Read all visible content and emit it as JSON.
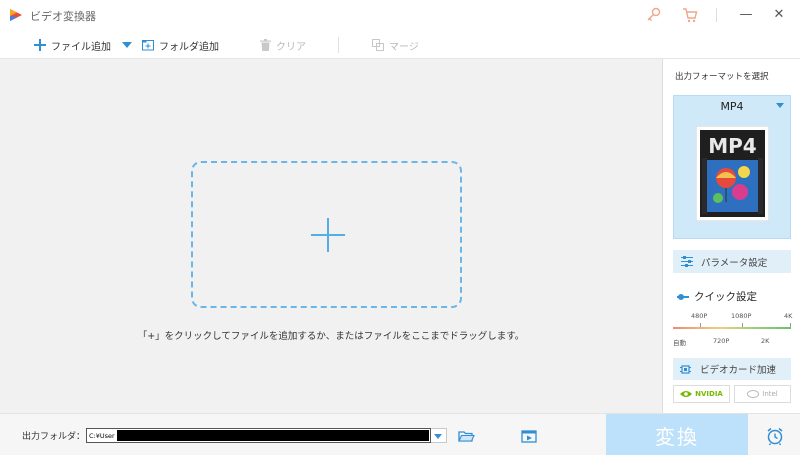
{
  "app": {
    "title": "ビデオ変換器"
  },
  "window": {
    "key_icon": "key-icon",
    "cart_icon": "cart-icon",
    "minimize": "—",
    "close": "✕"
  },
  "toolbar": {
    "add_file": "ファイル追加",
    "add_folder": "フォルダ追加",
    "clear": "クリア",
    "merge": "マージ"
  },
  "workspace": {
    "drop_hint": "「+」をクリックしてファイルを追加するか、またはファイルをここまでドラッグします。"
  },
  "right_panel": {
    "title": "出力フォーマットを選択",
    "format": "MP4",
    "format_icon_text": "MP4",
    "param_settings": "パラメータ設定",
    "quick_settings": "クイック設定",
    "quality_ticks_top": [
      "480P",
      "1080P",
      "4K"
    ],
    "quality_ticks_bottom": [
      "自動",
      "720P",
      "2K"
    ],
    "gpu_accel": "ビデオカード加速",
    "nvidia": "NVIDIA",
    "intel": "Intel"
  },
  "bottom": {
    "output_label": "出力フォルダ：",
    "output_path": "C:¥User",
    "convert": "変換"
  },
  "colors": {
    "accent": "#2f8fd4",
    "convert_disabled": "#bde1fb",
    "format_card": "#cfe9f8"
  }
}
